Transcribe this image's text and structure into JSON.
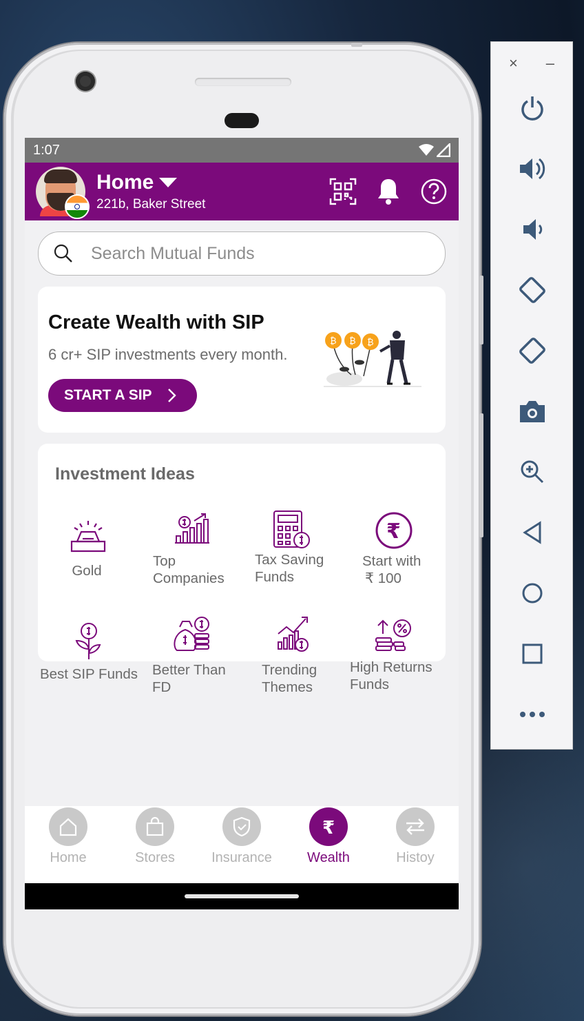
{
  "status_bar": {
    "time": "1:07"
  },
  "app_bar": {
    "location_title": "Home",
    "location_address": "221b, Baker Street"
  },
  "search": {
    "placeholder": "Search Mutual Funds"
  },
  "sip_card": {
    "title": "Create Wealth with SIP",
    "subtitle": "6 cr+ SIP investments every month.",
    "button_label": "START A SIP"
  },
  "ideas": {
    "title": "Investment Ideas",
    "items": [
      {
        "label_1": "Gold",
        "label_2": ""
      },
      {
        "label_1": "Top",
        "label_2": "Companies"
      },
      {
        "label_1": "Tax Saving",
        "label_2": "Funds"
      },
      {
        "label_1": "Start with",
        "label_2": "₹ 100"
      },
      {
        "label_1": "Best SIP Funds",
        "label_2": ""
      },
      {
        "label_1": "Better Than",
        "label_2": "FD"
      },
      {
        "label_1": "Trending",
        "label_2": "Themes"
      },
      {
        "label_1": "High Returns",
        "label_2": "Funds"
      }
    ]
  },
  "bottom_nav": [
    {
      "label": "Home",
      "icon": "home-icon"
    },
    {
      "label": "Stores",
      "icon": "shopping-bag-icon"
    },
    {
      "label": "Insurance",
      "icon": "shield-icon"
    },
    {
      "label": "Wealth",
      "icon": "rupee-icon",
      "active": true
    },
    {
      "label": "Histoy",
      "icon": "transfer-arrows-icon"
    }
  ],
  "colors": {
    "brand": "#7b0a7b",
    "inactive": "#b3b3b3"
  },
  "emulator_toolbar": {
    "close": "×",
    "minimize": "–",
    "tools": [
      "power-icon",
      "volume-up-icon",
      "volume-down-icon",
      "rotate-left-icon",
      "rotate-right-icon",
      "camera-icon",
      "zoom-icon",
      "back-icon",
      "home-circle-icon",
      "overview-icon",
      "more-icon"
    ]
  }
}
